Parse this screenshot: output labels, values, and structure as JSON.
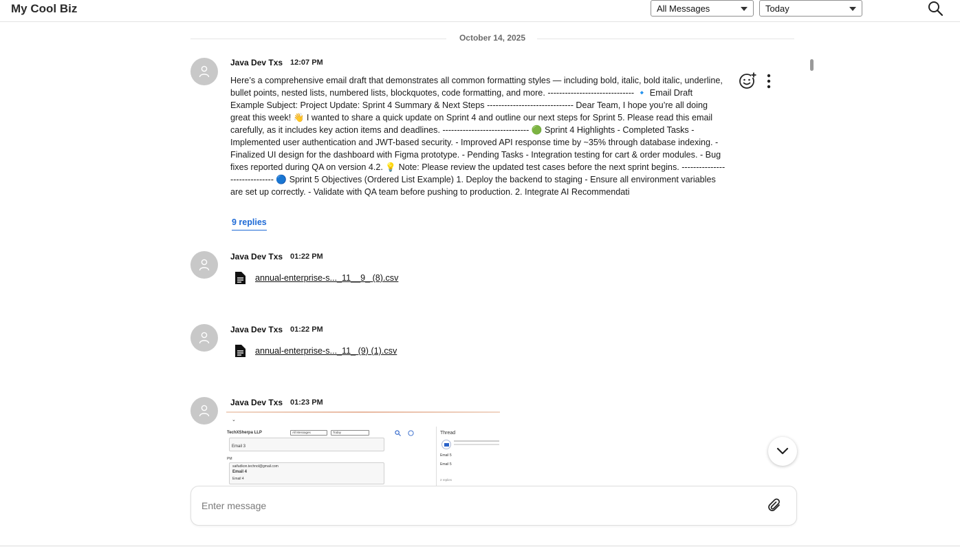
{
  "header": {
    "brand": "My Cool Biz",
    "filter_select": "All Messages",
    "date_select": "Today"
  },
  "date_divider": "October 14, 2025",
  "messages": [
    {
      "author": "Java Dev Txs",
      "time": "12:07 PM",
      "body": "Here’s a comprehensive email draft that demonstrates all common formatting styles — including bold, italic, bold italic, underline, bullet points, nested lists, numbered lists, blockquotes, code formatting, and more. ------------------------------ 🔹 Email Draft Example Subject: Project Update: Sprint 4 Summary & Next Steps ------------------------------ Dear Team, I hope you’re all doing great this week! 👋 I wanted to share a quick update on Sprint 4 and outline our next steps for Sprint 5. Please read this email carefully, as it includes key action items and deadlines. ------------------------------ 🟢 Sprint 4 Highlights - Completed Tasks - Implemented user authentication and JWT-based security. - Improved API response time by ~35% through database indexing. - Finalized UI design for the dashboard with Figma prototype. - Pending Tasks - Integration testing for cart & order modules. - Bug fixes reported during QA on version 4.2. 💡 Note: Please review the updated test cases before the next sprint begins. ------------------------------ 🔵 Sprint 5 Objectives (Ordered List Example) 1. Deploy the backend to staging - Ensure all environment variables are set up correctly. - Validate with QA team before pushing to production. 2. Integrate AI Recommendati",
      "replies": "9 replies"
    },
    {
      "author": "Java Dev Txs",
      "time": "01:22 PM",
      "file": "annual-enterprise-s..._11__9_ (8).csv"
    },
    {
      "author": "Java Dev Txs",
      "time": "01:22 PM",
      "file": "annual-enterprise-s..._11_ (9) (1).csv"
    },
    {
      "author": "Java Dev Txs",
      "time": "01:23 PM",
      "image": {
        "brand": "TechXSherpa LLP",
        "filter": "All Messages",
        "date": "Today",
        "thread_title": "Thread",
        "items": [
          "Email 3",
          "saifudkon.technol@gmail.com",
          "Email 4",
          "Email 4",
          "Email 5"
        ],
        "replies": "2 replies"
      }
    }
  ],
  "composer": {
    "placeholder": "Enter message"
  },
  "icons": {
    "search": "search-icon",
    "emoji": "add-reaction-icon",
    "more": "more-vertical-icon",
    "file": "document-icon",
    "attach": "paperclip-icon",
    "scroll_down": "chevron-down-icon"
  }
}
